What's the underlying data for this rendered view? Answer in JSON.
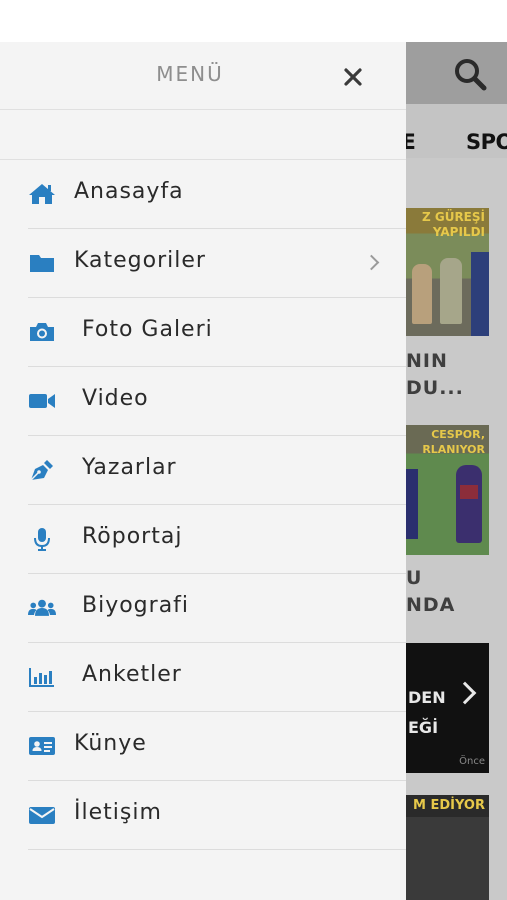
{
  "drawer": {
    "title": "MENÜ",
    "items": [
      {
        "label": "Anasayfa",
        "icon": "home-icon"
      },
      {
        "label": "Kategoriler",
        "icon": "folder-icon",
        "has_submenu": true
      },
      {
        "label": "Foto Galeri",
        "icon": "camera-icon"
      },
      {
        "label": "Video",
        "icon": "video-camera-icon"
      },
      {
        "label": "Yazarlar",
        "icon": "pen-nib-icon"
      },
      {
        "label": "Röportaj",
        "icon": "microphone-icon"
      },
      {
        "label": "Biyografi",
        "icon": "users-icon"
      },
      {
        "label": "Anketler",
        "icon": "bar-chart-icon"
      },
      {
        "label": "Künye",
        "icon": "id-card-icon"
      },
      {
        "label": "İletişim",
        "icon": "envelope-icon"
      }
    ]
  },
  "background": {
    "tabs": [
      "TRE",
      "SPO"
    ],
    "cards": [
      {
        "caption": "Z GÜREŞİ YAPILDI",
        "text_line1": "NIN",
        "text_line2": "DU..."
      },
      {
        "caption": "CESPOR, RLANIYOR",
        "text_line1": "U",
        "text_line2": "NDA"
      },
      {
        "caption_line1": "DEN",
        "caption_line2": "EĞİ",
        "logo": "Önce"
      },
      {
        "caption": "M EDİYOR"
      }
    ]
  },
  "colors": {
    "accent": "#2a7fc1",
    "drawer_bg": "#f4f4f4",
    "text": "#2a2a2a",
    "title": "#8e8e8e"
  }
}
